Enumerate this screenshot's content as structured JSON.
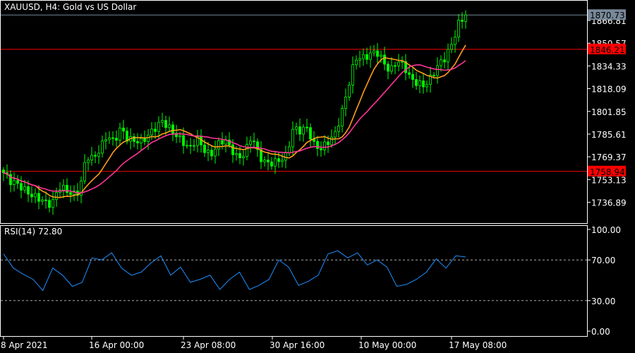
{
  "header": {
    "title": "XAUUSD, H4:  Gold vs US Dollar"
  },
  "rsi_label": "RSI(14) 72.80",
  "colors": {
    "bull": "#00ff00",
    "ma_fast": "#ff9d1a",
    "ma_slow": "#ff3399",
    "level": "#ff0000",
    "current": "#778899",
    "rsi": "#1e90ff"
  },
  "chart_data": [
    {
      "type": "candlestick",
      "title": "XAUUSD, H4",
      "ylim": [
        1728,
        1878
      ],
      "yticks": [
        "1866.81",
        "1850.57",
        "1834.33",
        "1818.09",
        "1801.85",
        "1785.61",
        "1769.37",
        "1753.13",
        "1736.89"
      ],
      "xticks": [
        "8 Apr 2021",
        "16 Apr 00:00",
        "23 Apr 08:00",
        "30 Apr 16:00",
        "10 May 00:00",
        "17 May 08:00"
      ],
      "current_price": "1870.73",
      "levels": [
        "1846.21",
        "1758.94"
      ],
      "close_anchors": [
        1758,
        1752,
        1750,
        1746,
        1742,
        1740,
        1737,
        1735,
        1748,
        1746,
        1742,
        1745,
        1770,
        1768,
        1775,
        1785,
        1780,
        1790,
        1782,
        1781,
        1780,
        1785,
        1790,
        1795,
        1790,
        1785,
        1780,
        1775,
        1783,
        1775,
        1770,
        1778,
        1782,
        1775,
        1768,
        1772,
        1785,
        1770,
        1765,
        1765,
        1767,
        1770,
        1790,
        1788,
        1790,
        1778,
        1775,
        1780,
        1785,
        1800,
        1820,
        1840,
        1840,
        1842,
        1845,
        1838,
        1830,
        1838,
        1835,
        1825,
        1822,
        1820,
        1826,
        1835,
        1840,
        1850,
        1865,
        1870
      ],
      "ma_periods": [
        10,
        20
      ]
    },
    {
      "type": "line",
      "title": "RSI(14)",
      "ylim": [
        0,
        100
      ],
      "yticks": [
        "100.00",
        "70.00",
        "30.00",
        "0.00"
      ],
      "levels": [
        70,
        30
      ],
      "values": [
        76,
        62,
        56,
        51,
        40,
        62,
        55,
        44,
        48,
        72,
        70,
        77,
        62,
        55,
        58,
        67,
        74,
        55,
        63,
        48,
        51,
        55,
        41,
        51,
        58,
        41,
        45,
        51,
        70,
        63,
        45,
        49,
        55,
        76,
        79,
        72,
        77,
        65,
        70,
        63,
        44,
        46,
        51,
        58,
        71,
        62,
        74,
        73
      ]
    }
  ]
}
